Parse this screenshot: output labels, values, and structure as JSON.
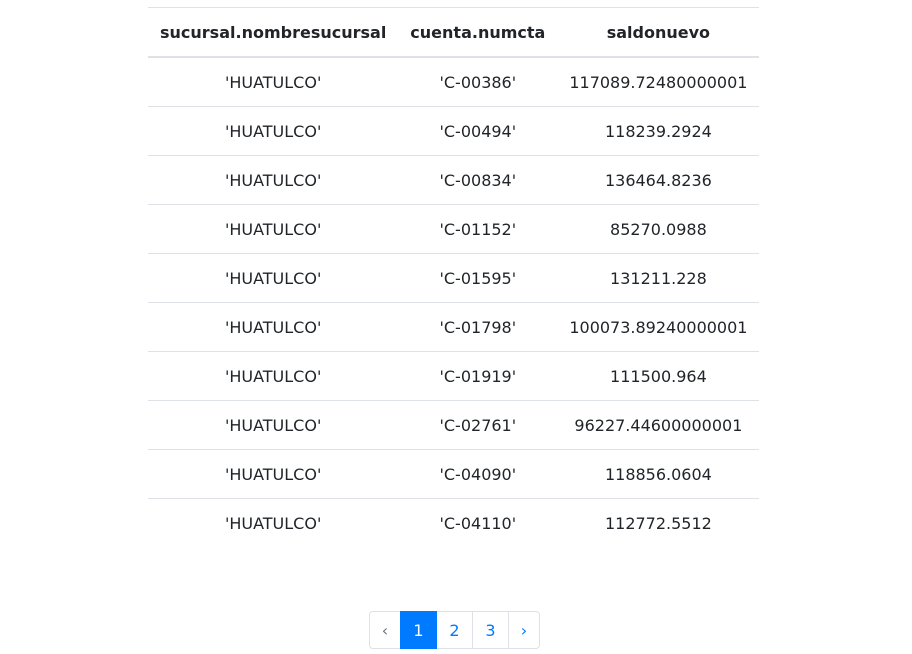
{
  "table": {
    "columns": [
      "sucursal.nombresucursal",
      "cuenta.numcta",
      "saldonuevo"
    ],
    "rows": [
      [
        "'HUATULCO'",
        "'C-00386'",
        "117089.72480000001"
      ],
      [
        "'HUATULCO'",
        "'C-00494'",
        "118239.2924"
      ],
      [
        "'HUATULCO'",
        "'C-00834'",
        "136464.8236"
      ],
      [
        "'HUATULCO'",
        "'C-01152'",
        "85270.0988"
      ],
      [
        "'HUATULCO'",
        "'C-01595'",
        "131211.228"
      ],
      [
        "'HUATULCO'",
        "'C-01798'",
        "100073.89240000001"
      ],
      [
        "'HUATULCO'",
        "'C-01919'",
        "111500.964"
      ],
      [
        "'HUATULCO'",
        "'C-02761'",
        "96227.44600000001"
      ],
      [
        "'HUATULCO'",
        "'C-04090'",
        "118856.0604"
      ],
      [
        "'HUATULCO'",
        "'C-04110'",
        "112772.5512"
      ]
    ]
  },
  "pagination": {
    "prev": "‹",
    "pages": [
      "1",
      "2",
      "3"
    ],
    "next": "›",
    "active_page": "1"
  },
  "colors": {
    "accent": "#007bff",
    "border": "#dee2e6",
    "text": "#212529",
    "disabled": "#6c757d"
  }
}
